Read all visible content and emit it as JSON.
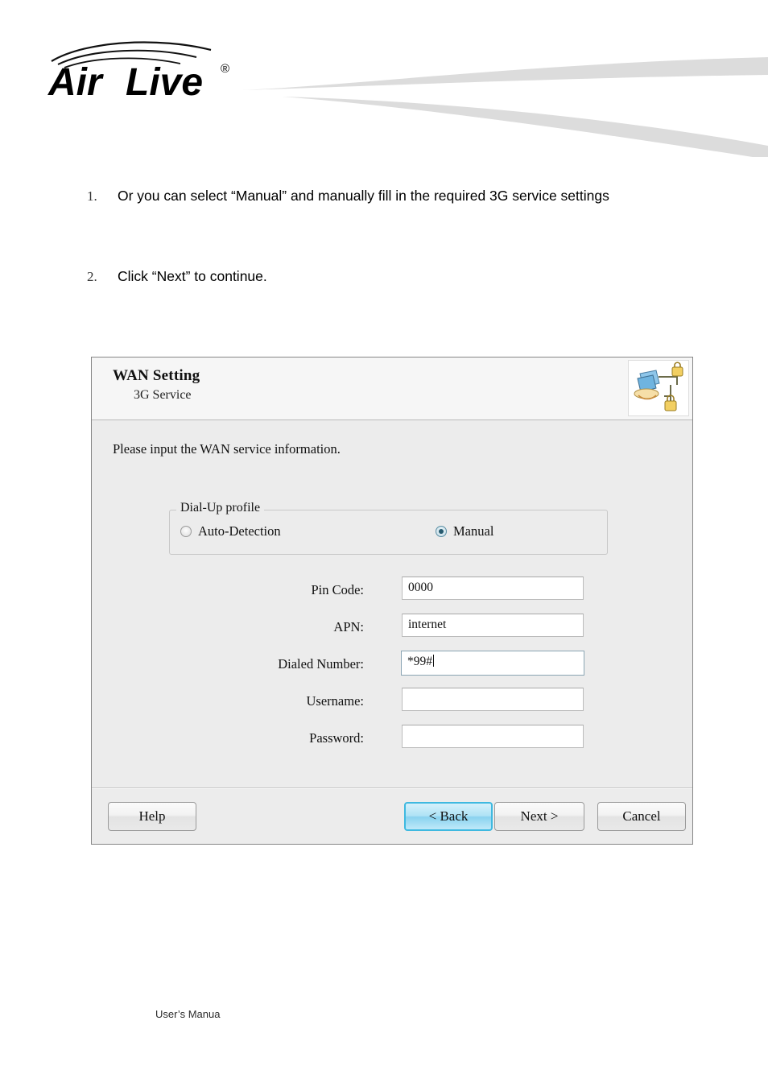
{
  "header": {
    "logo_text": "Air Live",
    "logo_trademark": "®",
    "logo_icon": "wifi-waves-icon"
  },
  "steps": [
    {
      "number": "1.",
      "text": "Or you can select “Manual” and manually fill in the required 3G service settings"
    },
    {
      "number": "2.",
      "text": "Click “Next” to continue."
    }
  ],
  "dialog": {
    "title": "WAN Setting",
    "subtitle": "3G Service",
    "icon": "network-lock-wizard-icon",
    "instruction": "Please input the WAN service information.",
    "groupbox": {
      "legend": "Dial-Up profile",
      "options": [
        {
          "label": "Auto-Detection",
          "selected": false
        },
        {
          "label": "Manual",
          "selected": true
        }
      ]
    },
    "fields": [
      {
        "label": "Pin Code:",
        "value": "0000",
        "focused": false
      },
      {
        "label": "APN:",
        "value": "internet",
        "focused": false
      },
      {
        "label": "Dialed Number:",
        "value": "*99#",
        "focused": true
      },
      {
        "label": "Username:",
        "value": "",
        "focused": false
      },
      {
        "label": "Password:",
        "value": "",
        "focused": false
      }
    ],
    "buttons": {
      "help": "Help",
      "back": "< Back",
      "next": "Next >",
      "cancel": "Cancel"
    },
    "accent_color": "#3fb9e0"
  },
  "footer": {
    "text": "User’s Manua"
  }
}
